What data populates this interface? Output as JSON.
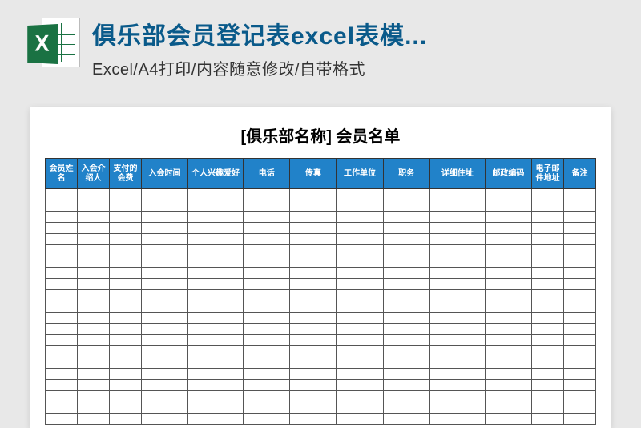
{
  "header": {
    "title": "俱乐部会员登记表excel表模...",
    "subtitle": "Excel/A4打印/内容随意修改/自带格式",
    "icon_letter": "X"
  },
  "sheet": {
    "title": "[俱乐部名称] 会员名单",
    "columns": [
      "会员姓名",
      "入会介绍人",
      "支付的会费",
      "入会时间",
      "个人兴趣爱好",
      "电话",
      "传真",
      "工作单位",
      "职务",
      "详细住址",
      "邮政编码",
      "电子邮件地址",
      "备注"
    ],
    "empty_rows": 21
  }
}
